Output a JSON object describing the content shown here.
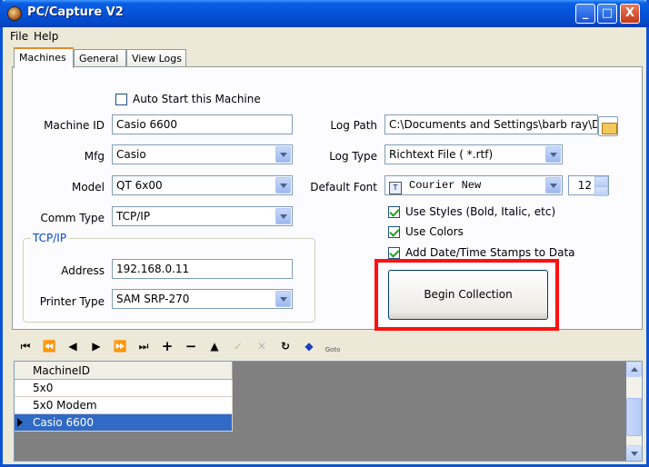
{
  "window": {
    "title": "PC/Capture V2",
    "minimize": "_",
    "maximize": "□",
    "close": "X"
  },
  "menu": {
    "file": "File",
    "help": "Help"
  },
  "tabs": [
    "Machines",
    "General",
    "View Logs"
  ],
  "machine": {
    "auto_start_label": "Auto Start this Machine",
    "auto_start_checked": false,
    "machine_id_label": "Machine ID",
    "machine_id_value": "Casio 6600",
    "mfg_label": "Mfg",
    "mfg_value": "Casio",
    "model_label": "Model",
    "model_value": "QT 6x00",
    "comm_type_label": "Comm Type",
    "comm_type_value": "TCP/IP"
  },
  "tcpip": {
    "group_title": "TCP/IP",
    "address_label": "Address",
    "address_value": "192.168.0.11",
    "printer_type_label": "Printer Type",
    "printer_type_value": "SAM SRP-270"
  },
  "log": {
    "log_path_label": "Log Path",
    "log_path_value": "C:\\Documents and Settings\\barb ray\\De",
    "log_type_label": "Log Type",
    "log_type_value": "Richtext File ( *.rtf)",
    "default_font_label": "Default Font",
    "default_font_value": "Courier New",
    "font_size_value": "12"
  },
  "options": {
    "use_styles": "Use Styles (Bold, Italic, etc)",
    "use_colors": "Use Colors",
    "add_timestamps": "Add Date/Time Stamps to Data"
  },
  "begin_button": "Begin Collection",
  "navigator": {
    "goto": "Goto"
  },
  "grid": {
    "column": "MachineID",
    "rows": [
      "5x0",
      "5x0 Modem",
      "Casio 6600"
    ],
    "selected_row": "Casio 6600"
  },
  "colors": {
    "highlight": "#ff1010",
    "selection": "#316ac5",
    "title_bar": "#0553d8"
  }
}
